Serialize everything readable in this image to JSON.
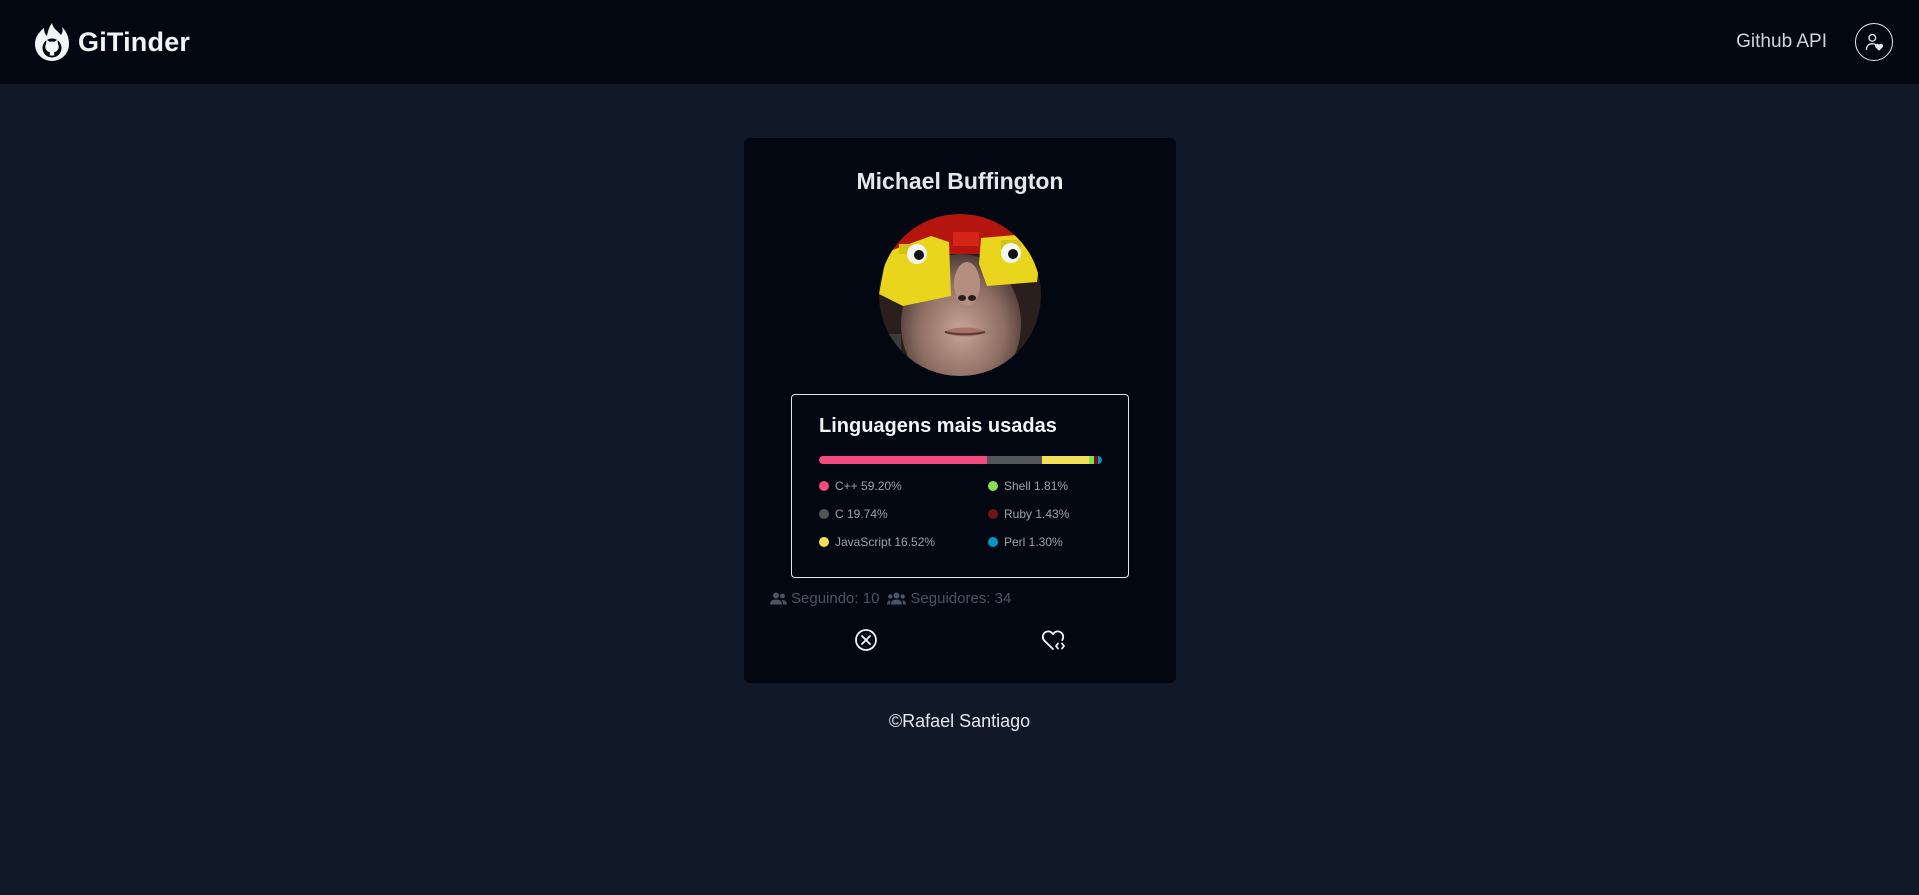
{
  "navbar": {
    "brand": "GiTinder",
    "link_label": "Github API",
    "profile_icon": "user-heart-icon",
    "logo_icon": "flame-octocat-logo"
  },
  "card": {
    "name": "Michael Buffington",
    "languages": {
      "title": "Linguagens mais usadas",
      "items": [
        {
          "name": "C++",
          "percent": 59.2,
          "label": "C++ 59.20%",
          "color": "#f34b7d"
        },
        {
          "name": "C",
          "percent": 19.74,
          "label": "C 19.74%",
          "color": "#555555"
        },
        {
          "name": "JavaScript",
          "percent": 16.52,
          "label": "JavaScript 16.52%",
          "color": "#f1e05a"
        },
        {
          "name": "Shell",
          "percent": 1.81,
          "label": "Shell 1.81%",
          "color": "#89e051"
        },
        {
          "name": "Ruby",
          "percent": 1.43,
          "label": "Ruby 1.43%",
          "color": "#701516"
        },
        {
          "name": "Perl",
          "percent": 1.3,
          "label": "Perl 1.30%",
          "color": "#0298c3"
        }
      ]
    },
    "stats": {
      "following_label": "Seguindo: 10",
      "followers_label": "Seguidores: 34"
    },
    "actions": {
      "reject_icon": "circle-x-icon",
      "like_icon": "heart-code-icon"
    }
  },
  "footer": {
    "text": "©Rafael Santiago"
  },
  "colors": {
    "background": "#111827",
    "navbar": "#030712",
    "card": "#030712",
    "text": "#e5e7eb",
    "muted": "#4b5563"
  }
}
